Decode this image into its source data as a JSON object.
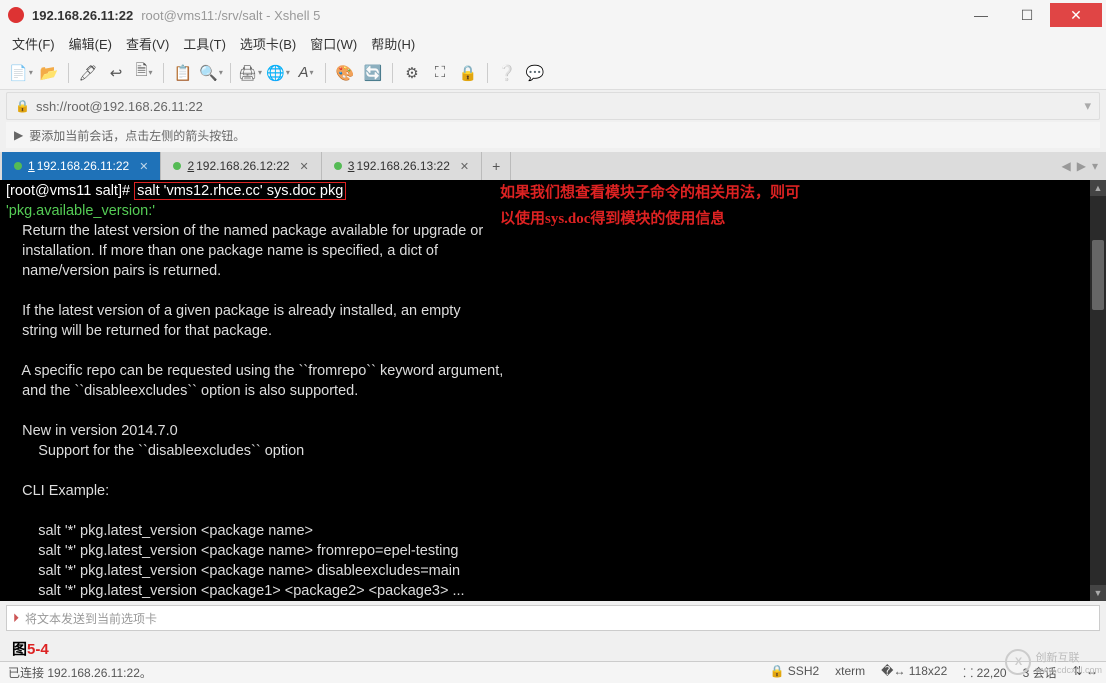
{
  "title": {
    "ip": "192.168.26.11:22",
    "sub": "root@vms11:/srv/salt - Xshell 5"
  },
  "winbtns": {
    "min": "—",
    "max": "☐",
    "close": "✕"
  },
  "menus": [
    "文件(F)",
    "编辑(E)",
    "查看(V)",
    "工具(T)",
    "选项卡(B)",
    "窗口(W)",
    "帮助(H)"
  ],
  "address": {
    "lock": "🔒",
    "url": "ssh://root@192.168.26.11:22"
  },
  "hint": {
    "arrow": "▶",
    "text": "要添加当前会话，点击左侧的箭头按钮。"
  },
  "tabs": [
    {
      "num": "1",
      "label": "192.168.26.11:22",
      "active": true
    },
    {
      "num": "2",
      "label": "192.168.26.12:22",
      "active": false
    },
    {
      "num": "3",
      "label": "192.168.26.13:22",
      "active": false
    }
  ],
  "terminal": {
    "prompt": "[root@vms11 salt]# ",
    "command": "salt 'vms12.rhce.cc' sys.doc pkg",
    "header": "'pkg.available_version:'",
    "body": "\n    Return the latest version of the named package available for upgrade or\n    installation. If more than one package name is specified, a dict of\n    name/version pairs is returned.\n\n    If the latest version of a given package is already installed, an empty\n    string will be returned for that package.\n\n    A specific repo can be requested using the ``fromrepo`` keyword argument,\n    and the ``disableexcludes`` option is also supported.\n\n    New in version 2014.7.0\n        Support for the ``disableexcludes`` option\n\n    CLI Example:\n\n        salt '*' pkg.latest_version <package name>\n        salt '*' pkg.latest_version <package name> fromrepo=epel-testing\n        salt '*' pkg.latest_version <package name> disableexcludes=main\n        salt '*' pkg.latest_version <package1> <package2> <package3> ...",
    "note1": "如果我们想查看模块子命令的相关用法，则可",
    "note2": "以使用sys.doc得到模块的使用信息"
  },
  "sendbar": {
    "placeholder": "将文本发送到当前选项卡"
  },
  "fig": {
    "k": "图",
    "r": "5-4"
  },
  "status": {
    "left": "已连接 192.168.26.11:22。",
    "ssh": "🔒 SSH2",
    "term": "xterm",
    "size": "�↔ 118x22",
    "pos": "⸬ 22,20",
    "sess": "3 会话",
    "more": "⇅ ↔"
  },
  "watermark": {
    "icon": "X",
    "text1": "创新互联",
    "text2": "www.cdcxhl.com"
  }
}
